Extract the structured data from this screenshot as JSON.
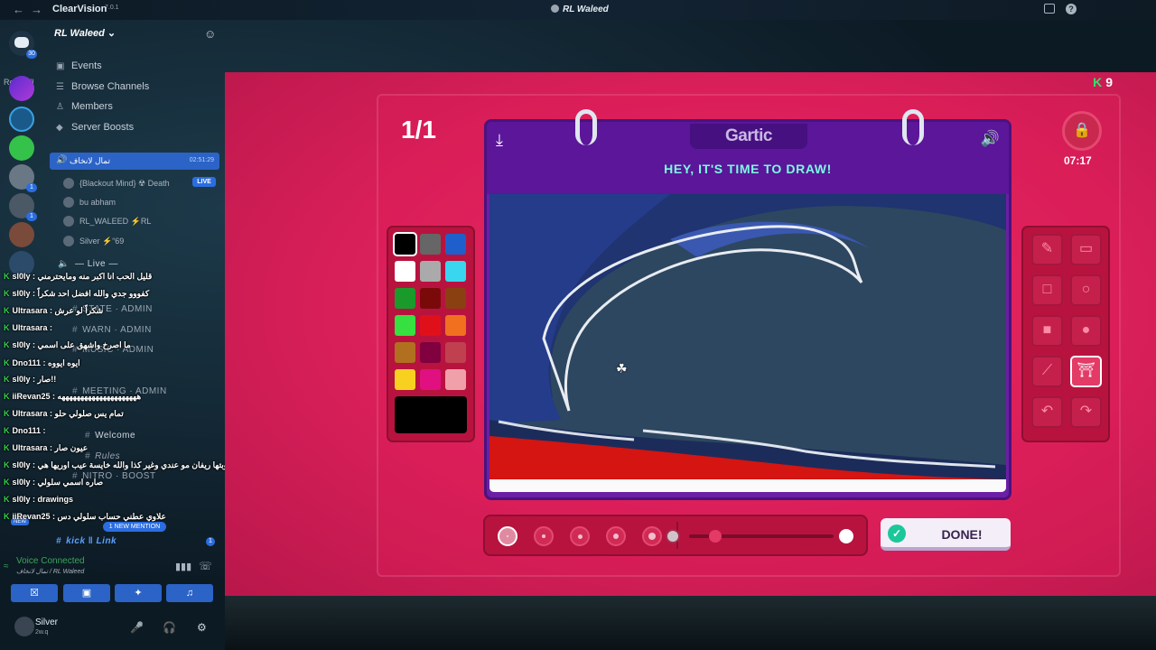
{
  "app": {
    "name": "ClearVision",
    "version": "7.0.1",
    "window_title": "RL Waleed"
  },
  "rail": {
    "read_all": "Read All",
    "home_badge": "30",
    "badges": [
      "1",
      "1",
      "1",
      "1"
    ]
  },
  "server": {
    "name": "RL Waleed"
  },
  "menu": [
    "Events",
    "Browse Channels",
    "Members",
    "Server Boosts"
  ],
  "voice_channel": {
    "name": "تمال لانخاف",
    "time": "02:51:29",
    "users": [
      {
        "name": "{Blackout Mind} ☢ Death"
      },
      {
        "name": "bu abham"
      },
      {
        "name": "RL_WALEED ⚡RL"
      },
      {
        "name": "Silver ⚡“69"
      }
    ],
    "live_label": "LIVE"
  },
  "channels": {
    "live": "— Live —",
    "rows": [
      "STATE · ADMIN",
      "WARN · ADMIN",
      "MUSIC · ADMIN",
      "MEETING · ADMIN",
      "Welcome",
      "Rules",
      "NITRO · BOOST",
      "kick ‖ Link"
    ],
    "mention": "1 NEW MENTION",
    "new": "NEW",
    "count_badge": "1"
  },
  "chat": [
    {
      "user": "sl0ly",
      "text": "قليل الحب انا اكبر منه ومايحترمني"
    },
    {
      "user": "sl0ly",
      "text": "كفووو جدي والله افضل احد شكراً"
    },
    {
      "user": "Ultrasara",
      "text": "شكراً لو عرش"
    },
    {
      "user": "Ultrasara",
      "text": ""
    },
    {
      "user": "sl0ly",
      "text": "ما اصرخ واشهق على اسمي"
    },
    {
      "user": "Dno111",
      "text": "ايوه ايووه"
    },
    {
      "user": "sl0ly",
      "text": "صار!!"
    },
    {
      "user": "iiRevan25",
      "text": "هههههههههههههههههههههه"
    },
    {
      "user": "Ultrasara",
      "text": "تمام يس صلولي حلو"
    },
    {
      "user": "Dno111",
      "text": ""
    },
    {
      "user": "Ultrasara",
      "text": "عيون صار"
    },
    {
      "user": "sl0ly",
      "text": "لا ماروبتها ريفان مو عندي وغير كذا والله خايسة عيب اوريها هي"
    },
    {
      "user": "sl0ly",
      "text": "صاره اسمي سلولي"
    },
    {
      "user": "sl0ly",
      "text": "drawings"
    },
    {
      "user": "iiRevan25",
      "text": "علاوي عطني حساب سلولي دس"
    }
  ],
  "voice": {
    "status": "Voice Connected",
    "location": "تمال لانخاف / RL Waleed"
  },
  "user": {
    "name": "Silver",
    "status": "2w.q"
  },
  "game": {
    "coins": "9",
    "round": "1/1",
    "timer": "07:17",
    "logo": "Gartic",
    "prompt": "HEY, IT'S TIME TO DRAW!",
    "done_label": "DONE!",
    "palette": [
      "#000000",
      "#666666",
      "#1f5fcc",
      "#ffffff",
      "#aaaaaa",
      "#3ad6f0",
      "#1a9a2a",
      "#7a0a0a",
      "#8a4010",
      "#35e040",
      "#e0101a",
      "#f07020",
      "#b07020",
      "#800040",
      "#c04050",
      "#f8d020",
      "#e01080",
      "#f0a0a8"
    ],
    "selected_color": "#000000",
    "brush_sizes": 5,
    "selected_size_index": 0,
    "opacity_level": 0.18,
    "accent": "#d91f5a"
  }
}
